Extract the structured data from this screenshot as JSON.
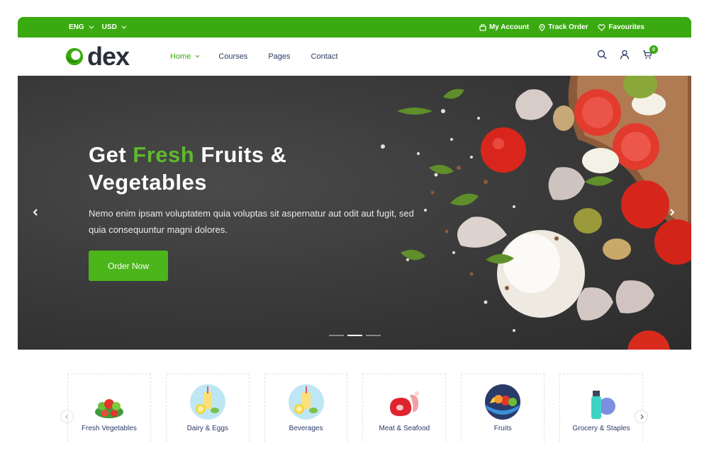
{
  "topbar": {
    "language": "ENG",
    "currency": "USD",
    "my_account": "My Account",
    "track_order": "Track Order",
    "favourites": "Favourites"
  },
  "header": {
    "logo_text": "dex",
    "nav": [
      {
        "label": "Home",
        "active": true
      },
      {
        "label": "Courses"
      },
      {
        "label": "Pages"
      },
      {
        "label": "Contact"
      }
    ],
    "cart_count": "0"
  },
  "hero": {
    "title_part1": "Get ",
    "title_highlight": "Fresh",
    "title_part2": " Fruits &",
    "title_line2": "Vegetables",
    "subtitle": "Nemo enim ipsam voluptatem quia voluptas sit aspernatur aut odit aut fugit, sed quia consequuntur magni dolores.",
    "cta_label": "Order Now",
    "slides": 3,
    "active_slide": 2
  },
  "categories": [
    {
      "label": "Fresh Vegetables",
      "icon": "vegetables-icon"
    },
    {
      "label": "Dairy & Eggs",
      "icon": "dairy-icon"
    },
    {
      "label": "Beverages",
      "icon": "beverage-icon"
    },
    {
      "label": "Meat & Seafood",
      "icon": "meat-icon"
    },
    {
      "label": "Fruits",
      "icon": "fruits-icon"
    },
    {
      "label": "Grocery & Staples",
      "icon": "grocery-icon"
    }
  ],
  "colors": {
    "brand_green": "#3aaa10",
    "accent_green": "#5dba2c",
    "nav_text": "#2b3a67",
    "hero_bg": "#383838"
  }
}
